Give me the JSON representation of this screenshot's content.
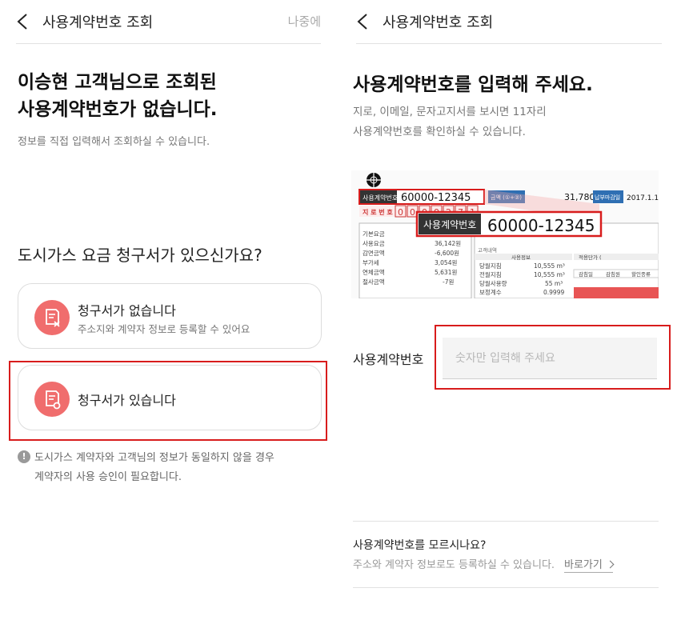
{
  "left": {
    "header": {
      "title": "사용계약번호 조회",
      "later": "나중에"
    },
    "title_lines": [
      "이승현 고객님으로 조회된",
      "사용계약번호가 없습니다."
    ],
    "subtitle": "정보를 직접 입력해서 조회하실 수 있습니다.",
    "question": "도시가스 요금 청구서가 있으신가요?",
    "options": [
      {
        "title": "청구서가 없습니다",
        "desc": "주소지와 계약자 정보로 등록할 수 있어요",
        "icon": "bill-x-icon"
      },
      {
        "title": "청구서가 있습니다",
        "desc": "",
        "icon": "bill-check-icon"
      }
    ],
    "notice_lines": [
      "도시가스 계약자와 고객님의 정보가 동일하지 않을 경우",
      "계약자의 사용 승인이 필요합니다."
    ]
  },
  "right": {
    "header": {
      "title": "사용계약번호 조회"
    },
    "title": "사용계약번호를 입력해 주세요.",
    "subtitle_lines": [
      "지로, 이메일, 문자고지서를 보시면 11자리",
      "사용계약번호를 확인하실 수 있습니다."
    ],
    "bill": {
      "small_label": "사용계약번호",
      "small_number": "60000-12345",
      "amount_label": "금액 (①+②)",
      "amount": "31,780원",
      "due_label": "납부마감일",
      "due_date": "2017.1.1",
      "giro_label": "지 로 번 호",
      "giro_digits": [
        "0",
        "0",
        "0",
        "0",
        "2",
        "7",
        "1"
      ],
      "callout_label": "사용계약번호",
      "callout_number": "60000-12345",
      "section_label": "청구내용",
      "rows": [
        {
          "label": "기본요금",
          "value": ""
        },
        {
          "label": "사용요금",
          "value": "36,142원"
        },
        {
          "label": "감면금액",
          "value": "-6,600원"
        },
        {
          "label": "부가세",
          "value": "3,054원"
        },
        {
          "label": "연체금액",
          "value": "5,631원"
        },
        {
          "label": "절사금액",
          "value": "-7원"
        }
      ],
      "usage_header": "사용정보",
      "usage_rows": [
        {
          "label": "당월지침",
          "value": "10,555 m³"
        },
        {
          "label": "전월지침",
          "value": "10,555 m³"
        },
        {
          "label": "당월사용량",
          "value": "55 m³"
        },
        {
          "label": "보정계수",
          "value": "0.9999"
        }
      ],
      "note_label": "고객내역",
      "rate_label": "적용단가 (",
      "rate_cols": [
        "감침일",
        "감침원",
        "할인종류"
      ]
    },
    "field": {
      "label": "사용계약번호",
      "placeholder": "숫자만 입력해 주세요"
    },
    "bottom": {
      "question": "사용계약번호를 모르시나요?",
      "desc": "주소와 계약자 정보로도 등록하실 수 있습니다.",
      "link": "바로가기"
    },
    "colors": {
      "highlight": "#d81c1c",
      "icon_bg": "#f06d6d",
      "bill_label_bg": "#333333",
      "bill_blue": "#2f6fb3"
    }
  }
}
